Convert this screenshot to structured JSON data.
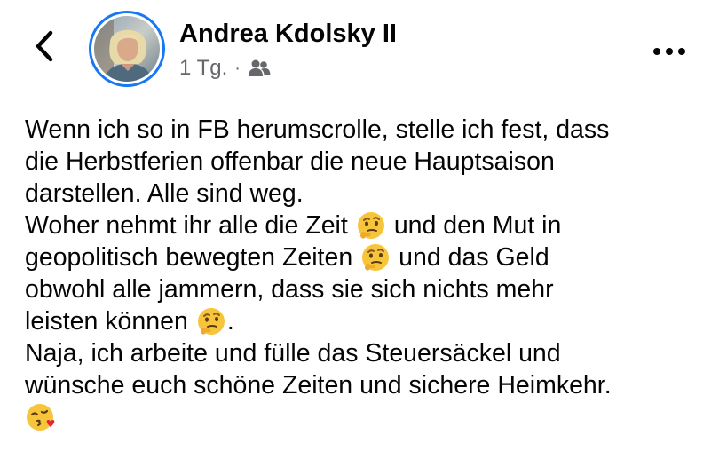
{
  "header": {
    "author_name": "Andrea Kdolsky II",
    "timestamp": "1 Tg.",
    "separator": "·",
    "audience_icon": "friends-icon",
    "back_icon": "chevron-left-icon",
    "more_icon": "more-horizontal-icon",
    "accent_color": "#1877f2"
  },
  "post": {
    "lines": [
      {
        "text": "Wenn ich so in FB herumscrolle, stelle ich fest, dass"
      },
      {
        "text": "die Herbstferien offenbar die neue Hauptsaison"
      },
      {
        "text": "darstellen. Alle sind weg."
      },
      {
        "before": "Woher nehmt ihr alle die Zeit",
        "emoji": "thinking-face-emoji",
        "after": "und den Mut in"
      },
      {
        "before": "geopolitisch bewegten Zeiten",
        "emoji": "thinking-face-emoji",
        "after": "und das Geld"
      },
      {
        "text": "obwohl alle jammern, dass sie sich nichts mehr"
      },
      {
        "before": "leisten können",
        "emoji": "thinking-face-emoji",
        "after": "."
      },
      {
        "text": "Naja, ich arbeite und fülle das Steuersäckel und"
      },
      {
        "text": "wünsche euch schöne Zeiten und sichere Heimkehr."
      },
      {
        "emoji_only": "face-blowing-kiss-emoji"
      }
    ]
  }
}
